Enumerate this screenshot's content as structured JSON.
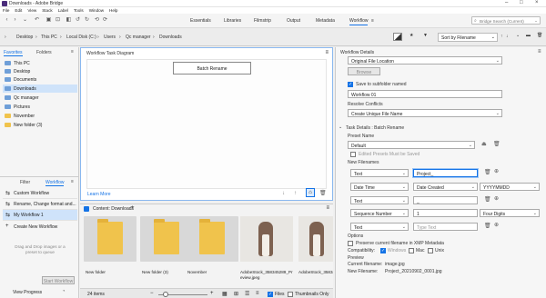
{
  "window": {
    "title": "Downloads - Adobe Bridge"
  },
  "menu": [
    "File",
    "Edit",
    "View",
    "Stack",
    "Label",
    "Tools",
    "Window",
    "Help"
  ],
  "workspaces": [
    "Essentials",
    "Libraries",
    "Filmstrip",
    "Output",
    "Metadata",
    "Workflow"
  ],
  "search": {
    "placeholder": "Bridge Search (Current)"
  },
  "breadcrumbs": [
    "Desktop",
    "This PC",
    "Local Disk (C:)",
    "Users",
    "Qc manager",
    "Downloads"
  ],
  "sort": {
    "label": "Sort by Filename"
  },
  "left_panel": {
    "tabs": [
      "Favorites",
      "Folders"
    ],
    "favorites": [
      "This PC",
      "Desktop",
      "Documents",
      "Downloads",
      "Qc manager",
      "Pictures",
      "November",
      "New folder (3)"
    ],
    "bottom_tabs": [
      "Filter",
      "Workflow"
    ],
    "workflows": [
      "Custom Workflow",
      "Rename, Change format and...",
      "My Workflow 1"
    ],
    "create_new": "Create New Workflow",
    "drop_hint": "Drag and Drop images or a preset to queue",
    "start_button": "Start Workflow",
    "view_progress": "View Progress"
  },
  "diagram": {
    "header": "Workflow Task Diagram",
    "task_box": "Batch Rename",
    "learn_more": "Learn More"
  },
  "content": {
    "header": "Content: Downloads",
    "items": [
      {
        "name": "New folder",
        "kind": "folder"
      },
      {
        "name": "New folder (3)",
        "kind": "folder"
      },
      {
        "name": "November",
        "kind": "folder"
      },
      {
        "name": "AdobeStock_358345289_Preview.jpeg",
        "kind": "photo"
      },
      {
        "name": "AdobeStock_358345289_Preview.jpeg",
        "kind": "photo"
      }
    ],
    "count": "24 items",
    "files_label": "Files",
    "thumbs_only": "Thumbnails Only"
  },
  "details": {
    "title": "Workflow Details",
    "location": "Original File Location",
    "browse": "Browse",
    "save_subfolder": "Save to subfolder named",
    "subfolder_name": "Workflow 01",
    "conflicts_label": "Resolve Conflicts",
    "conflicts_value": "Create Unique File Name",
    "task_details": "Task Details :  Batch Rename",
    "preset_label": "Preset Name",
    "preset_value": "Default",
    "edited_presets": "Edited Presets Must be Saved",
    "new_filenames": "New Filenames",
    "rows": [
      {
        "type": "Text",
        "value": "Project_",
        "extra": ""
      },
      {
        "type": "Date Time",
        "value": "Date Created",
        "extra": "YYYYMMDD"
      },
      {
        "type": "Text",
        "value": "_",
        "extra": ""
      },
      {
        "type": "Sequence Number",
        "value": "1",
        "extra": "Four Digits"
      },
      {
        "type": "Text",
        "value": "Type Text",
        "extra": ""
      }
    ],
    "options": "Options",
    "preserve": "Preserve current filename in XMP Metadata",
    "compatibility": "Compatibility:",
    "compat_opts": [
      "Windows",
      "Mac",
      "Unix"
    ],
    "preview": "Preview",
    "current_label": "Current filename:",
    "current_value": "image.jpg",
    "new_label": "New Filename:",
    "new_value": "Project_20210902_0001.jpg"
  },
  "colors": {
    "accent": "#1473e6",
    "folder": "#f0c34c",
    "selection": "#cfe3fa"
  }
}
